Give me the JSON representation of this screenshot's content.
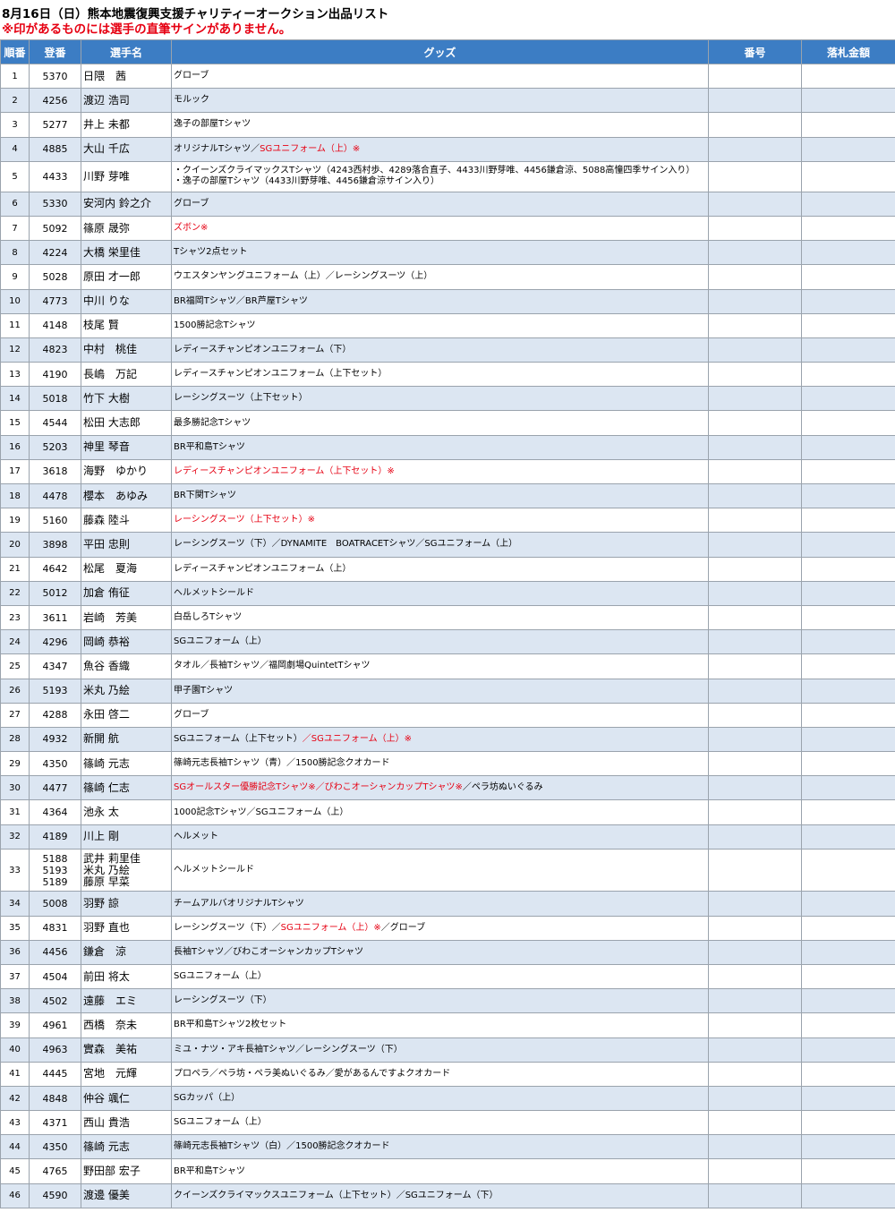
{
  "header": {
    "title": "8月16日（日）熊本地震復興支援チャリティーオークション出品リスト",
    "note": "※印があるものには選手の直筆サインがありません。"
  },
  "table": {
    "columns": [
      "順番",
      "登番",
      "選手名",
      "グッズ",
      "番号",
      "落札金額"
    ],
    "rows": [
      {
        "no": "1",
        "reg": [
          "5370"
        ],
        "name": [
          "日隈　茜"
        ],
        "goods": [
          [
            {
              "t": "グローブ",
              "red": false
            }
          ]
        ]
      },
      {
        "no": "2",
        "reg": [
          "4256"
        ],
        "name": [
          "渡辺 浩司"
        ],
        "goods": [
          [
            {
              "t": "モルック",
              "red": false
            }
          ]
        ]
      },
      {
        "no": "3",
        "reg": [
          "5277"
        ],
        "name": [
          "井上 未都"
        ],
        "goods": [
          [
            {
              "t": "逸子の部屋Tシャツ",
              "red": false
            }
          ]
        ]
      },
      {
        "no": "4",
        "reg": [
          "4885"
        ],
        "name": [
          "大山 千広"
        ],
        "goods": [
          [
            {
              "t": "オリジナルTシャツ／",
              "red": false
            },
            {
              "t": "SGユニフォーム（上）※",
              "red": true
            }
          ]
        ]
      },
      {
        "no": "5",
        "reg": [
          "4433"
        ],
        "name": [
          "川野 芽唯"
        ],
        "goods": [
          [
            {
              "t": "・クイーンズクライマックスTシャツ（4243西村歩、4289落合直子、4433川野芽唯、4456鎌倉涼、5088高憧四季サイン入り）",
              "red": false
            }
          ],
          [
            {
              "t": "・逸子の部屋Tシャツ（4433川野芽唯、4456鎌倉涼サイン入り）",
              "red": false
            }
          ]
        ]
      },
      {
        "no": "6",
        "reg": [
          "5330"
        ],
        "name": [
          "安河内 鈴之介"
        ],
        "goods": [
          [
            {
              "t": "グローブ",
              "red": false
            }
          ]
        ]
      },
      {
        "no": "7",
        "reg": [
          "5092"
        ],
        "name": [
          "篠原 晟弥"
        ],
        "goods": [
          [
            {
              "t": "ズボン※",
              "red": true
            }
          ]
        ]
      },
      {
        "no": "8",
        "reg": [
          "4224"
        ],
        "name": [
          "大橋 栄里佳"
        ],
        "goods": [
          [
            {
              "t": "Tシャツ2点セット",
              "red": false
            }
          ]
        ]
      },
      {
        "no": "9",
        "reg": [
          "5028"
        ],
        "name": [
          "原田 才一郎"
        ],
        "goods": [
          [
            {
              "t": "ウエスタンヤングユニフォーム（上）／レーシングスーツ（上）",
              "red": false
            }
          ]
        ]
      },
      {
        "no": "10",
        "reg": [
          "4773"
        ],
        "name": [
          "中川 りな"
        ],
        "goods": [
          [
            {
              "t": "BR福岡Tシャツ／BR芦屋Tシャツ",
              "red": false
            }
          ]
        ]
      },
      {
        "no": "11",
        "reg": [
          "4148"
        ],
        "name": [
          "枝尾 賢"
        ],
        "goods": [
          [
            {
              "t": "1500勝記念Tシャツ",
              "red": false
            }
          ]
        ]
      },
      {
        "no": "12",
        "reg": [
          "4823"
        ],
        "name": [
          "中村　桃佳"
        ],
        "goods": [
          [
            {
              "t": "レディースチャンピオンユニフォーム（下）",
              "red": false
            }
          ]
        ]
      },
      {
        "no": "13",
        "reg": [
          "4190"
        ],
        "name": [
          "長嶋　万記"
        ],
        "goods": [
          [
            {
              "t": "レディースチャンピオンユニフォーム（上下セット）",
              "red": false
            }
          ]
        ]
      },
      {
        "no": "14",
        "reg": [
          "5018"
        ],
        "name": [
          "竹下 大樹"
        ],
        "goods": [
          [
            {
              "t": "レーシングスーツ（上下セット）",
              "red": false
            }
          ]
        ]
      },
      {
        "no": "15",
        "reg": [
          "4544"
        ],
        "name": [
          "松田 大志郎"
        ],
        "goods": [
          [
            {
              "t": "最多勝記念Tシャツ",
              "red": false
            }
          ]
        ]
      },
      {
        "no": "16",
        "reg": [
          "5203"
        ],
        "name": [
          "神里 琴音"
        ],
        "goods": [
          [
            {
              "t": "BR平和島Tシャツ",
              "red": false
            }
          ]
        ]
      },
      {
        "no": "17",
        "reg": [
          "3618"
        ],
        "name": [
          "海野　ゆかり"
        ],
        "goods": [
          [
            {
              "t": "レディースチャンピオンユニフォーム（上下セット）※",
              "red": true
            }
          ]
        ]
      },
      {
        "no": "18",
        "reg": [
          "4478"
        ],
        "name": [
          "櫻本　あゆみ"
        ],
        "goods": [
          [
            {
              "t": "BR下関Tシャツ",
              "red": false
            }
          ]
        ]
      },
      {
        "no": "19",
        "reg": [
          "5160"
        ],
        "name": [
          "藤森 陸斗"
        ],
        "goods": [
          [
            {
              "t": "レーシングスーツ（上下セット）※",
              "red": true
            }
          ]
        ]
      },
      {
        "no": "20",
        "reg": [
          "3898"
        ],
        "name": [
          "平田 忠則"
        ],
        "goods": [
          [
            {
              "t": "レーシングスーツ（下）／DYNAMITE　BOATRACETシャツ／SGユニフォーム（上）",
              "red": false
            }
          ]
        ]
      },
      {
        "no": "21",
        "reg": [
          "4642"
        ],
        "name": [
          "松尾　夏海"
        ],
        "goods": [
          [
            {
              "t": "レディースチャンピオンユニフォーム（上）",
              "red": false
            }
          ]
        ]
      },
      {
        "no": "22",
        "reg": [
          "5012"
        ],
        "name": [
          "加倉 侑征"
        ],
        "goods": [
          [
            {
              "t": "ヘルメットシールド",
              "red": false
            }
          ]
        ]
      },
      {
        "no": "23",
        "reg": [
          "3611"
        ],
        "name": [
          "岩崎　芳美"
        ],
        "goods": [
          [
            {
              "t": "白岳しろTシャツ",
              "red": false
            }
          ]
        ]
      },
      {
        "no": "24",
        "reg": [
          "4296"
        ],
        "name": [
          "岡崎 恭裕"
        ],
        "goods": [
          [
            {
              "t": "SGユニフォーム（上）",
              "red": false
            }
          ]
        ]
      },
      {
        "no": "25",
        "reg": [
          "4347"
        ],
        "name": [
          "魚谷 香織"
        ],
        "goods": [
          [
            {
              "t": "タオル／長袖Tシャツ／福岡劇場QuintetTシャツ",
              "red": false
            }
          ]
        ]
      },
      {
        "no": "26",
        "reg": [
          "5193"
        ],
        "name": [
          "米丸 乃絵"
        ],
        "goods": [
          [
            {
              "t": "甲子園Tシャツ",
              "red": false
            }
          ]
        ]
      },
      {
        "no": "27",
        "reg": [
          "4288"
        ],
        "name": [
          "永田 啓二"
        ],
        "goods": [
          [
            {
              "t": "グローブ",
              "red": false
            }
          ]
        ]
      },
      {
        "no": "28",
        "reg": [
          "4932"
        ],
        "name": [
          "新開 航"
        ],
        "goods": [
          [
            {
              "t": "SGユニフォーム（上下セット）",
              "red": false
            },
            {
              "t": "／SGユニフォーム（上）※",
              "red": true
            }
          ]
        ]
      },
      {
        "no": "29",
        "reg": [
          "4350"
        ],
        "name": [
          "篠崎 元志"
        ],
        "goods": [
          [
            {
              "t": "篠崎元志長袖Tシャツ（青）／1500勝記念クオカード",
              "red": false
            }
          ]
        ]
      },
      {
        "no": "30",
        "reg": [
          "4477"
        ],
        "name": [
          "篠崎 仁志"
        ],
        "goods": [
          [
            {
              "t": "SGオールスター優勝記念Tシャツ※／びわこオーシャンカップTシャツ※",
              "red": true
            },
            {
              "t": "／ペラ坊ぬいぐるみ",
              "red": false
            }
          ]
        ]
      },
      {
        "no": "31",
        "reg": [
          "4364"
        ],
        "name": [
          "池永 太"
        ],
        "goods": [
          [
            {
              "t": "1000記念Tシャツ／SGユニフォーム（上）",
              "red": false
            }
          ]
        ]
      },
      {
        "no": "32",
        "reg": [
          "4189"
        ],
        "name": [
          "川上 剛"
        ],
        "goods": [
          [
            {
              "t": "ヘルメット",
              "red": false
            }
          ]
        ]
      },
      {
        "no": "33",
        "reg": [
          "5188",
          "5193",
          "5189"
        ],
        "name": [
          "武井 莉里佳",
          "米丸 乃絵",
          "藤原 早菜"
        ],
        "goods": [
          [
            {
              "t": "ヘルメットシールド",
              "red": false
            }
          ]
        ]
      },
      {
        "no": "34",
        "reg": [
          "5008"
        ],
        "name": [
          "羽野 諒"
        ],
        "goods": [
          [
            {
              "t": "チームアルバオリジナルTシャツ",
              "red": false
            }
          ]
        ]
      },
      {
        "no": "35",
        "reg": [
          "4831"
        ],
        "name": [
          "羽野 直也"
        ],
        "goods": [
          [
            {
              "t": "レーシングスーツ（下）／",
              "red": false
            },
            {
              "t": "SGユニフォーム（上）※",
              "red": true
            },
            {
              "t": "／グローブ",
              "red": false
            }
          ]
        ]
      },
      {
        "no": "36",
        "reg": [
          "4456"
        ],
        "name": [
          "鎌倉　涼"
        ],
        "goods": [
          [
            {
              "t": "長袖Tシャツ／びわこオーシャンカップTシャツ",
              "red": false
            }
          ]
        ]
      },
      {
        "no": "37",
        "reg": [
          "4504"
        ],
        "name": [
          "前田 将太"
        ],
        "goods": [
          [
            {
              "t": "SGユニフォーム（上）",
              "red": false
            }
          ]
        ]
      },
      {
        "no": "38",
        "reg": [
          "4502"
        ],
        "name": [
          "遠藤　エミ"
        ],
        "goods": [
          [
            {
              "t": "レーシングスーツ（下）",
              "red": false
            }
          ]
        ]
      },
      {
        "no": "39",
        "reg": [
          "4961"
        ],
        "name": [
          "西橋　奈未"
        ],
        "goods": [
          [
            {
              "t": "BR平和島Tシャツ2枚セット",
              "red": false
            }
          ]
        ]
      },
      {
        "no": "40",
        "reg": [
          "4963"
        ],
        "name": [
          "實森　美祐"
        ],
        "goods": [
          [
            {
              "t": "ミユ・ナツ・アキ長袖Tシャツ／レーシングスーツ（下）",
              "red": false
            }
          ]
        ]
      },
      {
        "no": "41",
        "reg": [
          "4445"
        ],
        "name": [
          "宮地　元輝"
        ],
        "goods": [
          [
            {
              "t": "プロペラ／ペラ坊・ペラ美ぬいぐるみ／愛があるんですよクオカード",
              "red": false
            }
          ]
        ]
      },
      {
        "no": "42",
        "reg": [
          "4848"
        ],
        "name": [
          "仲谷 颯仁"
        ],
        "goods": [
          [
            {
              "t": "SGカッパ（上）",
              "red": false
            }
          ]
        ]
      },
      {
        "no": "43",
        "reg": [
          "4371"
        ],
        "name": [
          "西山 貴浩"
        ],
        "goods": [
          [
            {
              "t": "SGユニフォーム（上）",
              "red": false
            }
          ]
        ]
      },
      {
        "no": "44",
        "reg": [
          "4350"
        ],
        "name": [
          "篠崎 元志"
        ],
        "goods": [
          [
            {
              "t": "篠崎元志長袖Tシャツ（白）／1500勝記念クオカード",
              "red": false
            }
          ]
        ]
      },
      {
        "no": "45",
        "reg": [
          "4765"
        ],
        "name": [
          "野田部 宏子"
        ],
        "goods": [
          [
            {
              "t": "BR平和島Tシャツ",
              "red": false
            }
          ]
        ]
      },
      {
        "no": "46",
        "reg": [
          "4590"
        ],
        "name": [
          "渡邊 優美"
        ],
        "goods": [
          [
            {
              "t": "クイーンズクライマックスユニフォーム（上下セット）／SGユニフォーム（下）",
              "red": false
            }
          ]
        ]
      }
    ]
  }
}
